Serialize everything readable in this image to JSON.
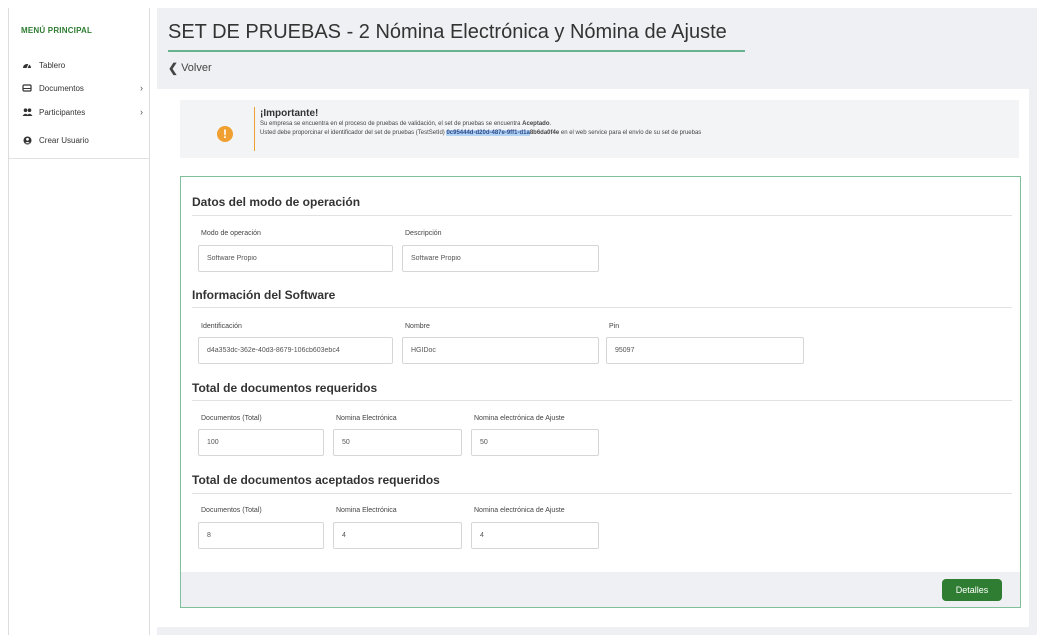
{
  "sidebar": {
    "menu_title": "MENÚ PRINCIPAL",
    "items": [
      {
        "label": "Tablero",
        "icon": "dashboard-icon"
      },
      {
        "label": "Documentos",
        "icon": "inbox-icon"
      },
      {
        "label": "Participantes",
        "icon": "users-icon"
      },
      {
        "label": "Crear Usuario",
        "icon": "user-add-icon"
      }
    ],
    "chevron": "›"
  },
  "header": {
    "title": "SET DE PRUEBAS - 2 Nómina Electrónica y Nómina de Ajuste",
    "back_label": "Volver"
  },
  "alert": {
    "icon": "!",
    "title": "¡Importante!",
    "line1_pre": "Su empresa se encuentra en el proceso de pruebas de validación, el set de pruebas se encuentra ",
    "line1_status": "Aceptado",
    "line1_post": ".",
    "line2_pre": "Usted debe proporcinar el identificador del set de pruebas (TestSetId) ",
    "test_set_id_highlighted": "0c95444d-d20d-487e-9ff1-d1a",
    "test_set_id_rest": "8b6da0f4e",
    "line2_post": " en el web service para el envío de su set de pruebas"
  },
  "sections": {
    "operation": {
      "title": "Datos del modo de operación",
      "mode_label": "Modo de operación",
      "mode_value": "Software Propio",
      "description_label": "Descripción",
      "description_value": "Software Propio"
    },
    "software": {
      "title": "Información del Software",
      "id_label": "Identificación",
      "id_value": "d4a353dc-362e-40d3-8679-106cb603ebc4",
      "name_label": "Nombre",
      "name_value": "HGIDoc",
      "pin_label": "Pin",
      "pin_value": "95097"
    },
    "required": {
      "title": "Total de documentos requeridos",
      "total_label": "Documentos (Total)",
      "total_value": "100",
      "payroll_label": "Nomina Electrónica",
      "payroll_value": "50",
      "adjust_label": "Nomina electrónica de Ajuste",
      "adjust_value": "50"
    },
    "accepted": {
      "title": "Total de documentos aceptados requeridos",
      "total_label": "Documentos (Total)",
      "total_value": "8",
      "payroll_label": "Nomina Electrónica",
      "payroll_value": "4",
      "adjust_label": "Nomina electrónica de Ajuste",
      "adjust_value": "4"
    }
  },
  "footer": {
    "details_label": "Detalles"
  },
  "colors": {
    "brand_green": "#2e7d32",
    "accent_green": "#67b38f",
    "warning": "#f0a030",
    "highlight": "#b3d4f5"
  }
}
